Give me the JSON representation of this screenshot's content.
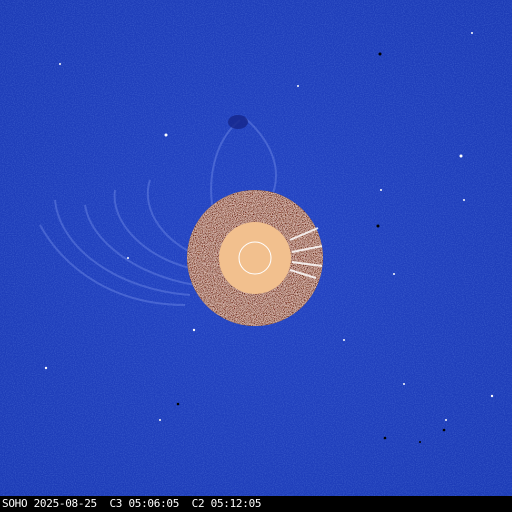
{
  "image": {
    "caption": "SOHO 2025-08-25  C3 05:06:05  C2 05:12:05",
    "colors": {
      "background": "#1f3fbf",
      "background_dark": "#1a35a6",
      "occulter_disk": "#f2c08e",
      "solar_limb": "#ffffff",
      "c2_field": "#5a2a1c",
      "caption_bar": "#000000",
      "caption_text": "#ffffff"
    }
  }
}
